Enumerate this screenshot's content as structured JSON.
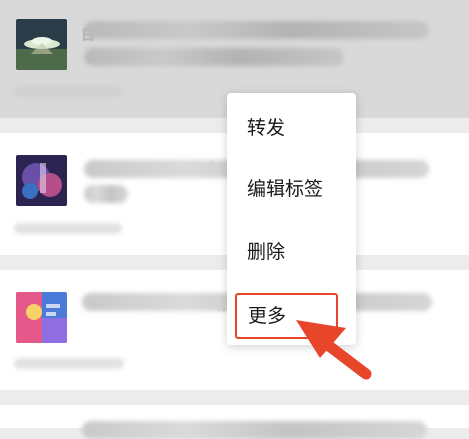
{
  "context_menu": {
    "items": [
      {
        "label": "转发"
      },
      {
        "label": "编辑标签"
      },
      {
        "label": "删除"
      },
      {
        "label": "更多"
      }
    ],
    "highlighted_index": 3
  },
  "colors": {
    "highlight": "#e8462b",
    "selected_row": "#d9d9d9"
  },
  "list_items": [
    {
      "peek": "日"
    },
    {
      "peek": "小"
    },
    {
      "peek": "标"
    },
    {
      "peek": ""
    }
  ]
}
